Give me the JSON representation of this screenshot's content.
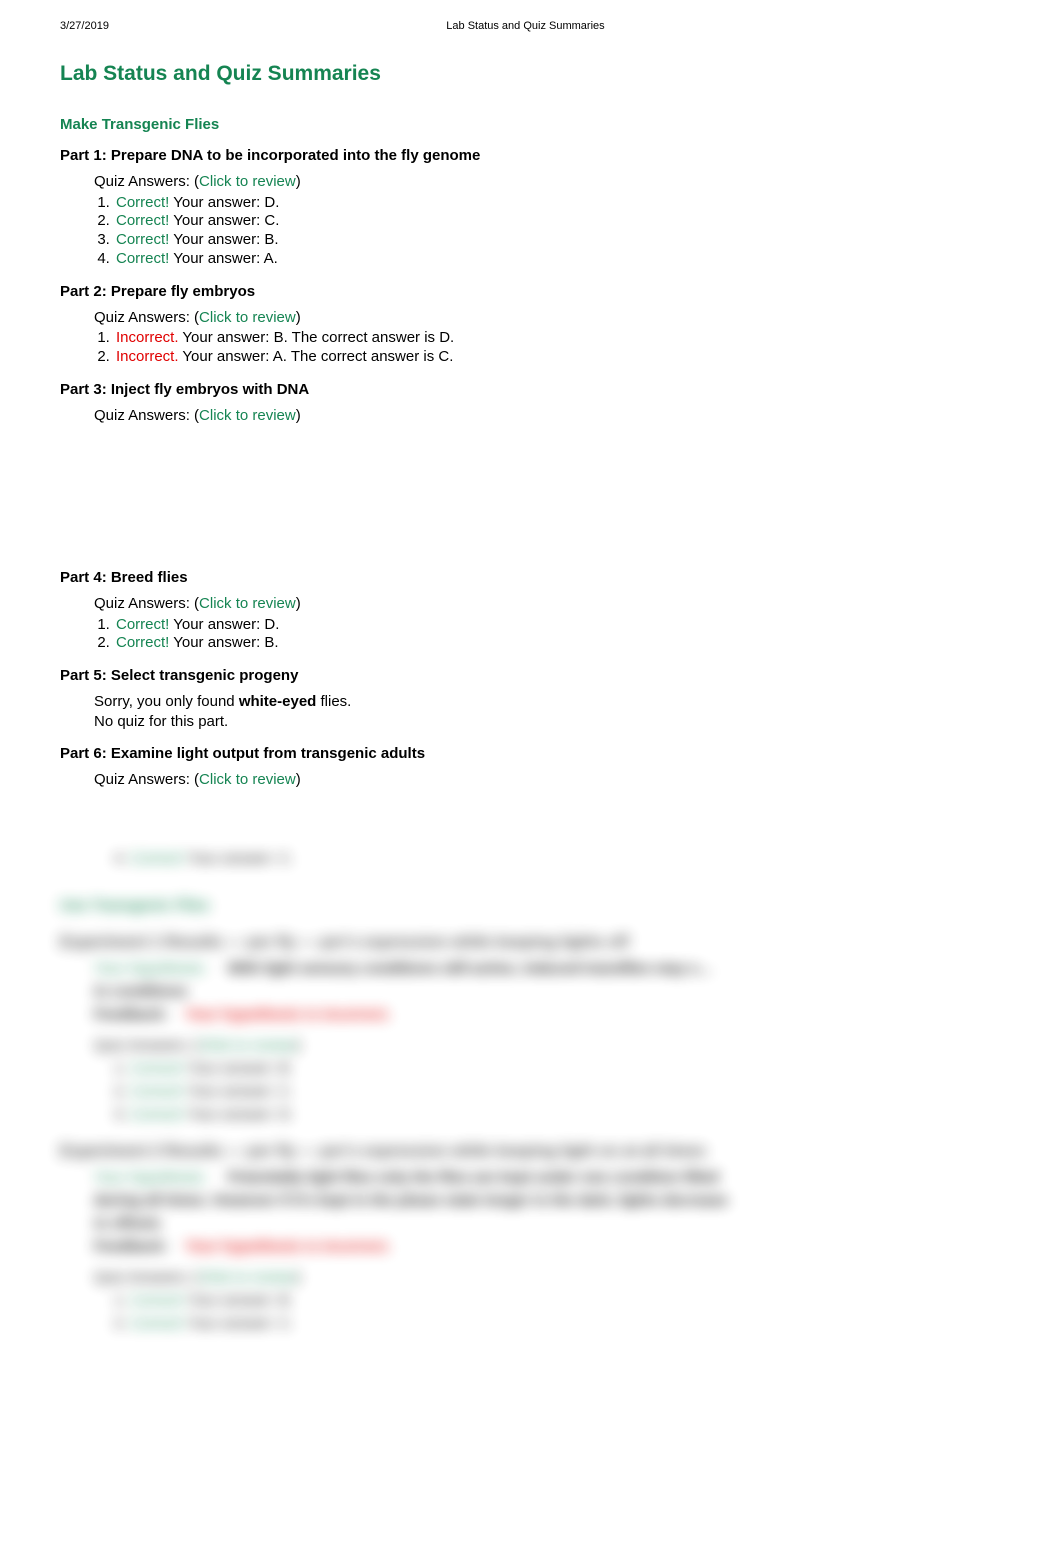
{
  "header": {
    "date": "3/27/2019",
    "doc_title": "Lab Status and Quiz Summaries"
  },
  "page_title": "Lab Status and Quiz Summaries",
  "section_title": "Make Transgenic Flies",
  "labels": {
    "quiz_answers_prefix": "Quiz Answers: (",
    "click_to_review": "Click to review",
    "quiz_answers_suffix": ")",
    "correct": "Correct!",
    "incorrect": "Incorrect.",
    "your_answer_prefix": " Your answer: ",
    "correct_answer_prefix": " The correct answer is "
  },
  "parts": [
    {
      "heading": "Part 1: Prepare DNA to be incorporated into the fly genome",
      "show_review": true,
      "answers": [
        {
          "status": "correct",
          "your": "D"
        },
        {
          "status": "correct",
          "your": "C"
        },
        {
          "status": "correct",
          "your": "B"
        },
        {
          "status": "correct",
          "your": "A"
        }
      ]
    },
    {
      "heading": "Part 2: Prepare fly embryos",
      "show_review": true,
      "answers": [
        {
          "status": "incorrect",
          "your": "B",
          "correct": "D"
        },
        {
          "status": "incorrect",
          "your": "A",
          "correct": "C"
        }
      ]
    },
    {
      "heading": "Part 3: Inject fly embryos with DNA",
      "show_review": true,
      "answers": [],
      "gap_after": true
    },
    {
      "heading": "Part 4: Breed flies",
      "show_review": true,
      "answers": [
        {
          "status": "correct",
          "your": "D"
        },
        {
          "status": "correct",
          "your": "B"
        }
      ]
    },
    {
      "heading": "Part 5: Select transgenic progeny",
      "show_review": false,
      "note_lines": [
        {
          "pre": "Sorry, you only found ",
          "bold": "white-eyed",
          "post": " flies."
        },
        {
          "pre": "No quiz for this part.",
          "bold": "",
          "post": ""
        }
      ],
      "answers": []
    },
    {
      "heading": "Part 6: Examine light output from transgenic adults",
      "show_review": true,
      "answers": []
    }
  ],
  "blurred": {
    "tail_answer": {
      "num": "4.",
      "status": "Correct!",
      "text": "Your answer: C."
    },
    "section2_title": "Use Transgenic Flies",
    "exp1": {
      "title": "Experiment 1 Results — per fly — per's expression while keeping lights off",
      "hyp_label": "Your Hypothesis:",
      "hyp_text": "With light sensory conditions still active, induced transflies may s…",
      "incond": "in conditions",
      "feedback_label": "Feedback:",
      "feedback_text": "Your hypothesis is incorrect.",
      "quiz_label": "Quiz Answers: (",
      "review": "Click to review",
      "suffix": ")",
      "answers": [
        {
          "n": "1.",
          "s": "Correct!",
          "t": "Your answer: B."
        },
        {
          "n": "2.",
          "s": "Correct!",
          "t": "Your answer: C."
        },
        {
          "n": "3.",
          "s": "Correct!",
          "t": "Your answer: D."
        }
      ]
    },
    "exp2": {
      "title": "Experiment 2 Results — per fly — per's expression while keeping light on at all times",
      "hyp_label": "Your Hypothesis:",
      "hyp_text": "Potentially light flies only the flies are kept under one condition filled",
      "hyp_text2": "during all times. However if it's kept in the phase state longer in the dark, lights decrease",
      "incond": "in offsets",
      "feedback_label": "Feedback:",
      "feedback_text": "Your hypothesis is incorrect.",
      "quiz_label": "Quiz Answers: (",
      "review": "Click to review",
      "suffix": ")",
      "answers": [
        {
          "n": "1.",
          "s": "Correct!",
          "t": "Your answer: B."
        },
        {
          "n": "2.",
          "s": "Correct!",
          "t": "Your answer: C."
        }
      ]
    }
  }
}
